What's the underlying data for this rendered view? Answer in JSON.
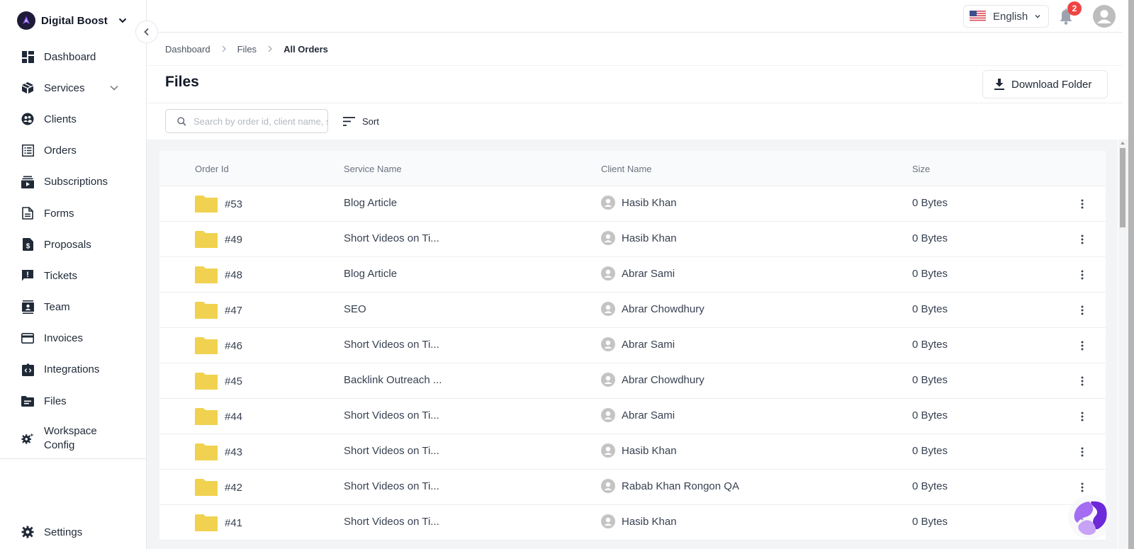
{
  "brand": {
    "name": "Digital Boost",
    "logo": "workspace-logo"
  },
  "sidebar": {
    "items": [
      {
        "label": "Dashboard",
        "icon": "dashboard-icon"
      },
      {
        "label": "Services",
        "icon": "box-icon",
        "has_submenu": true
      },
      {
        "label": "Clients",
        "icon": "clients-icon"
      },
      {
        "label": "Orders",
        "icon": "orders-icon"
      },
      {
        "label": "Subscriptions",
        "icon": "subscriptions-icon"
      },
      {
        "label": "Forms",
        "icon": "forms-icon"
      },
      {
        "label": "Proposals",
        "icon": "proposals-icon"
      },
      {
        "label": "Tickets",
        "icon": "tickets-icon"
      },
      {
        "label": "Team",
        "icon": "team-icon"
      },
      {
        "label": "Invoices",
        "icon": "invoices-icon"
      },
      {
        "label": "Integrations",
        "icon": "integrations-icon"
      },
      {
        "label": "Files",
        "icon": "files-icon",
        "active": true
      },
      {
        "label": "Workspace Config",
        "icon": "workspace-config-icon"
      }
    ],
    "settings": {
      "label": "Settings",
      "icon": "settings-icon"
    }
  },
  "topbar": {
    "language": "English",
    "language_flag": "us-flag",
    "notifications_count": "2"
  },
  "breadcrumb": [
    "Dashboard",
    "Files",
    "All Orders"
  ],
  "page": {
    "title": "Files",
    "download_label": "Download Folder"
  },
  "toolbar": {
    "search_placeholder": "Search by order id, client name, service name",
    "search_value": "",
    "sort_label": "Sort"
  },
  "table": {
    "columns": [
      "Order Id",
      "Service Name",
      "Client Name",
      "Size"
    ],
    "rows": [
      {
        "order_id": "#53",
        "service": "Blog Article",
        "client": "Hasib Khan",
        "size": "0 Bytes"
      },
      {
        "order_id": "#49",
        "service": "Short Videos on Ti...",
        "client": "Hasib Khan",
        "size": "0 Bytes"
      },
      {
        "order_id": "#48",
        "service": "Blog Article",
        "client": "Abrar Sami",
        "size": "0 Bytes"
      },
      {
        "order_id": "#47",
        "service": "SEO",
        "client": "Abrar Chowdhury",
        "size": "0 Bytes"
      },
      {
        "order_id": "#46",
        "service": "Short Videos on Ti...",
        "client": "Abrar Sami",
        "size": "0 Bytes"
      },
      {
        "order_id": "#45",
        "service": "Backlink Outreach ...",
        "client": "Abrar Chowdhury",
        "size": "0 Bytes"
      },
      {
        "order_id": "#44",
        "service": "Short Videos on Ti...",
        "client": "Abrar Sami",
        "size": "0 Bytes"
      },
      {
        "order_id": "#43",
        "service": "Short Videos on Ti...",
        "client": "Hasib Khan",
        "size": "0 Bytes"
      },
      {
        "order_id": "#42",
        "service": "Short Videos on Ti...",
        "client": "Rabab Khan Rongon QA",
        "size": "0 Bytes"
      },
      {
        "order_id": "#41",
        "service": "Short Videos on Ti...",
        "client": "Hasib Khan",
        "size": "0 Bytes"
      }
    ]
  },
  "colors": {
    "folder": "#f0d250",
    "badge": "#ef4444",
    "chat_primary": "#6d28d9",
    "chat_light": "#b98cf5"
  }
}
